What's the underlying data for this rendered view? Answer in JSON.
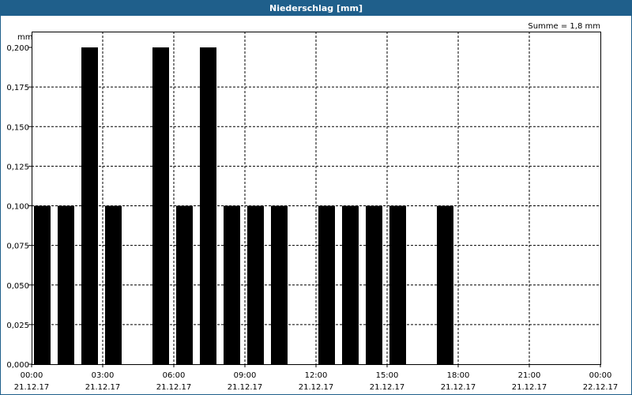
{
  "window": {
    "title": "Niederschlag [mm]"
  },
  "summary": "Summe = 1,8 mm",
  "colors": {
    "titlebar": "#1f5f8b",
    "bars": "#000000",
    "grid": "#000000"
  },
  "chart_data": {
    "type": "bar",
    "ylabel": "mm",
    "ylim": [
      0,
      0.2
    ],
    "yticks": [
      {
        "value": 0.0,
        "label": "0,000"
      },
      {
        "value": 0.025,
        "label": "0,025"
      },
      {
        "value": 0.05,
        "label": "0,050"
      },
      {
        "value": 0.075,
        "label": "0,075"
      },
      {
        "value": 0.1,
        "label": "0,100"
      },
      {
        "value": 0.125,
        "label": "0,125"
      },
      {
        "value": 0.15,
        "label": "0,150"
      },
      {
        "value": 0.175,
        "label": "0,175"
      },
      {
        "value": 0.2,
        "label": "0,200"
      }
    ],
    "xlim_hours": [
      0,
      24
    ],
    "xticks": [
      {
        "hour": 0,
        "time": "00:00",
        "date": "21.12.17"
      },
      {
        "hour": 3,
        "time": "03:00",
        "date": "21.12.17"
      },
      {
        "hour": 6,
        "time": "06:00",
        "date": "21.12.17"
      },
      {
        "hour": 9,
        "time": "09:00",
        "date": "21.12.17"
      },
      {
        "hour": 12,
        "time": "12:00",
        "date": "21.12.17"
      },
      {
        "hour": 15,
        "time": "15:00",
        "date": "21.12.17"
      },
      {
        "hour": 18,
        "time": "18:00",
        "date": "21.12.17"
      },
      {
        "hour": 21,
        "time": "21:00",
        "date": "21.12.17"
      },
      {
        "hour": 24,
        "time": "00:00",
        "date": "22.12.17"
      }
    ],
    "bars": [
      {
        "hour": 0,
        "value": 0.1
      },
      {
        "hour": 1,
        "value": 0.1
      },
      {
        "hour": 2,
        "value": 0.2
      },
      {
        "hour": 3,
        "value": 0.1
      },
      {
        "hour": 4,
        "value": 0
      },
      {
        "hour": 5,
        "value": 0.2
      },
      {
        "hour": 6,
        "value": 0.1
      },
      {
        "hour": 7,
        "value": 0.2
      },
      {
        "hour": 8,
        "value": 0.1
      },
      {
        "hour": 9,
        "value": 0.1
      },
      {
        "hour": 10,
        "value": 0.1
      },
      {
        "hour": 11,
        "value": 0
      },
      {
        "hour": 12,
        "value": 0.1
      },
      {
        "hour": 13,
        "value": 0.1
      },
      {
        "hour": 14,
        "value": 0.1
      },
      {
        "hour": 15,
        "value": 0.1
      },
      {
        "hour": 16,
        "value": 0
      },
      {
        "hour": 17,
        "value": 0.1
      },
      {
        "hour": 18,
        "value": 0
      },
      {
        "hour": 19,
        "value": 0
      },
      {
        "hour": 20,
        "value": 0
      },
      {
        "hour": 21,
        "value": 0
      },
      {
        "hour": 22,
        "value": 0
      },
      {
        "hour": 23,
        "value": 0
      }
    ],
    "grid": true
  }
}
